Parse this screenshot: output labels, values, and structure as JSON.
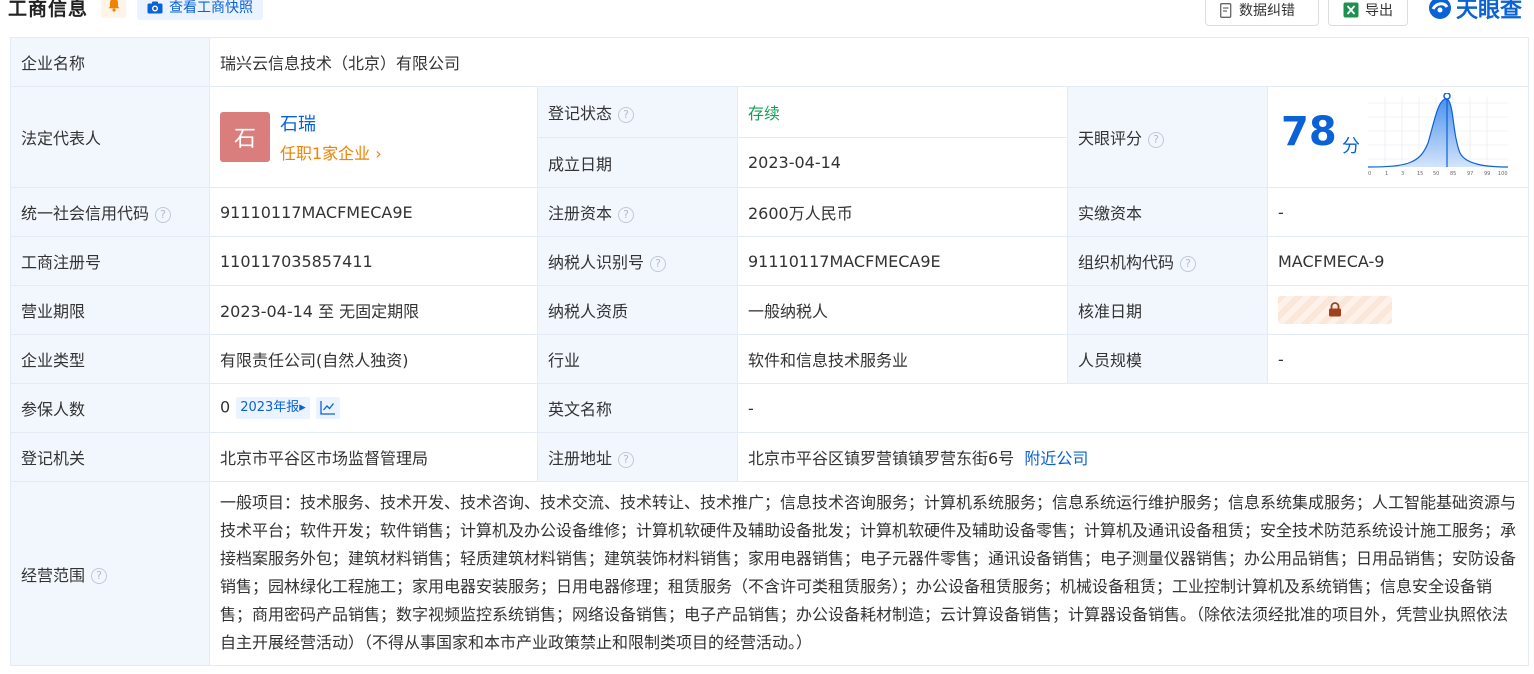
{
  "header": {
    "title": "工商信息",
    "snapshot_button": "查看工商快照",
    "correct_button": "数据纠错",
    "export_button": "导出",
    "logo_text": "天眼查"
  },
  "rows": {
    "company_name": {
      "label": "企业名称",
      "value": "瑞兴云信息技术（北京）有限公司"
    },
    "legal_rep": {
      "label": "法定代表人",
      "avatar_char": "石",
      "name": "石瑞",
      "sub": "任职1家企业 ›"
    },
    "reg_status": {
      "label": "登记状态",
      "value": "存续"
    },
    "found_date": {
      "label": "成立日期",
      "value": "2023-04-14"
    },
    "tianyan_score": {
      "label": "天眼评分",
      "score": "78",
      "unit": "分",
      "axis_ticks": [
        "0",
        "1",
        "3",
        "15",
        "50",
        "85",
        "97",
        "99",
        "100"
      ]
    },
    "credit_code": {
      "label": "统一社会信用代码",
      "value": "91110117MACFMECA9E"
    },
    "reg_capital": {
      "label": "注册资本",
      "value": "2600万人民币"
    },
    "paid_capital": {
      "label": "实缴资本",
      "value": "-"
    },
    "biz_reg_no": {
      "label": "工商注册号",
      "value": "110117035857411"
    },
    "taxpayer_id": {
      "label": "纳税人识别号",
      "value": "91110117MACFMECA9E"
    },
    "org_code": {
      "label": "组织机构代码",
      "value": "MACFMECA-9"
    },
    "biz_term": {
      "label": "营业期限",
      "value": "2023-04-14 至 无固定期限"
    },
    "taxpayer_qual": {
      "label": "纳税人资质",
      "value": "一般纳税人"
    },
    "approve_date": {
      "label": "核准日期"
    },
    "company_type": {
      "label": "企业类型",
      "value": "有限责任公司(自然人独资)"
    },
    "industry": {
      "label": "行业",
      "value": "软件和信息技术服务业"
    },
    "staff_size": {
      "label": "人员规模",
      "value": "-"
    },
    "insured": {
      "label": "参保人数",
      "value": "0",
      "report_tag": "2023年报▸"
    },
    "english_name": {
      "label": "英文名称",
      "value": "-"
    },
    "reg_authority": {
      "label": "登记机关",
      "value": "北京市平谷区市场监督管理局"
    },
    "reg_address": {
      "label": "注册地址",
      "value": "北京市平谷区镇罗营镇镇罗营东街6号",
      "nearby_link": "附近公司"
    },
    "biz_scope": {
      "label": "经营范围",
      "value": "一般项目：技术服务、技术开发、技术咨询、技术交流、技术转让、技术推广；信息技术咨询服务；计算机系统服务；信息系统运行维护服务；信息系统集成服务；人工智能基础资源与技术平台；软件开发；软件销售；计算机及办公设备维修；计算机软硬件及辅助设备批发；计算机软硬件及辅助设备零售；计算机及通讯设备租赁；安全技术防范系统设计施工服务；承接档案服务外包；建筑材料销售；轻质建筑材料销售；建筑装饰材料销售；家用电器销售；电子元器件零售；通讯设备销售；电子测量仪器销售；办公用品销售；日用品销售；安防设备销售；园林绿化工程施工；家用电器安装服务；日用电器修理；租赁服务（不含许可类租赁服务）；办公设备租赁服务；机械设备租赁；工业控制计算机及系统销售；信息安全设备销售；商用密码产品销售；数字视频监控系统销售；网络设备销售；电子产品销售；办公设备耗材制造；云计算设备销售；计算器设备销售。（除依法须经批准的项目外，凭营业执照依法自主开展经营活动）（不得从事国家和本市产业政策禁止和限制类项目的经营活动。）"
    }
  }
}
